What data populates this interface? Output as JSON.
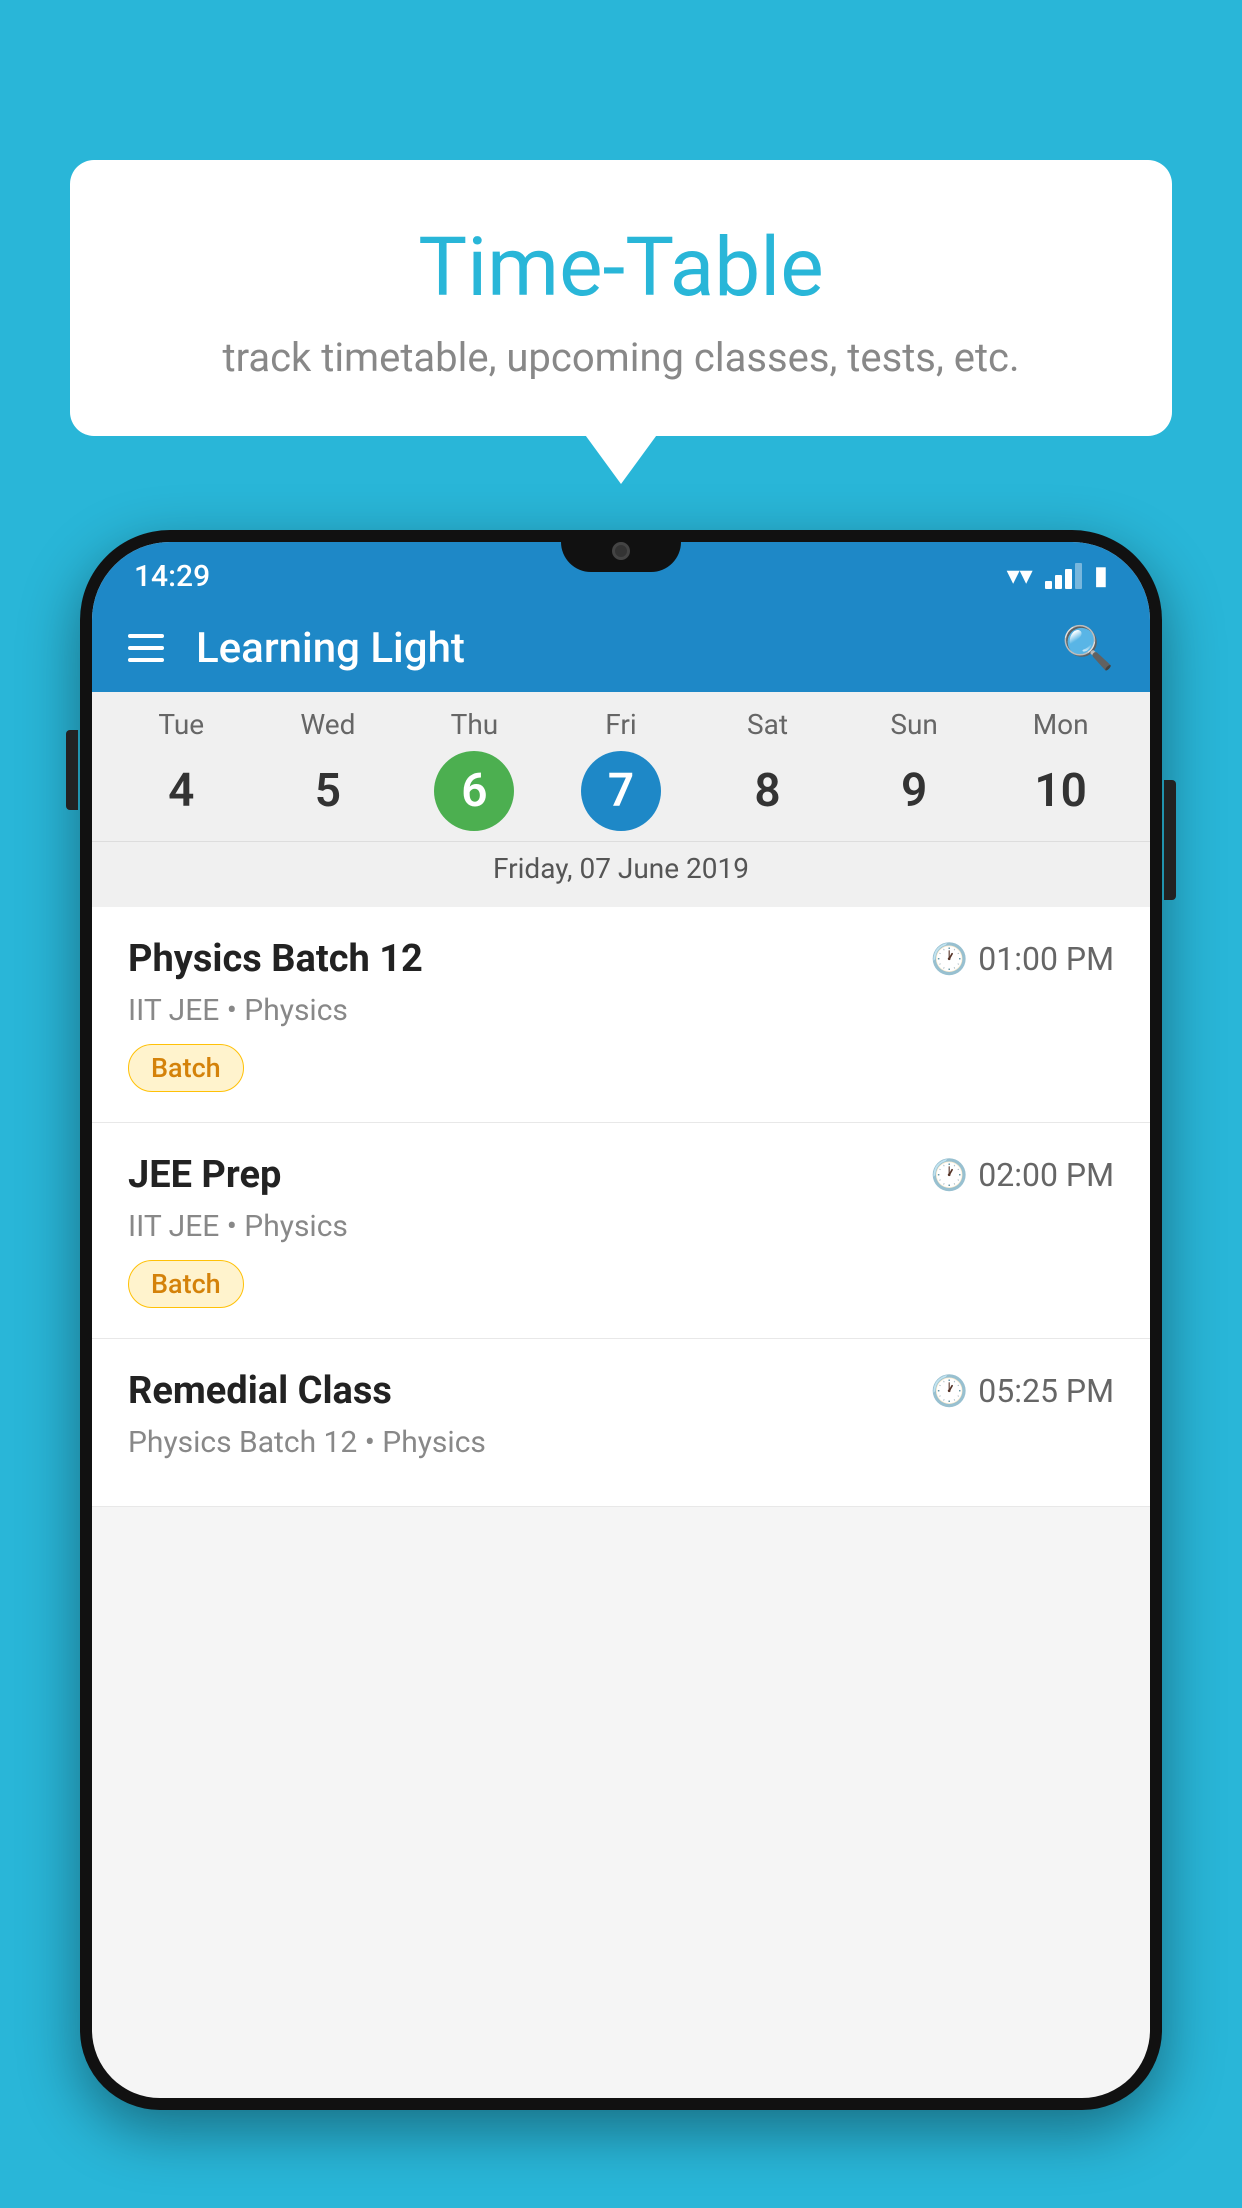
{
  "background_color": "#29b6d8",
  "speech_bubble": {
    "title": "Time-Table",
    "subtitle": "track timetable, upcoming classes, tests, etc."
  },
  "phone": {
    "status_bar": {
      "time": "14:29"
    },
    "toolbar": {
      "app_name": "Learning Light"
    },
    "calendar": {
      "days": [
        {
          "name": "Tue",
          "number": "4",
          "state": "normal"
        },
        {
          "name": "Wed",
          "number": "5",
          "state": "normal"
        },
        {
          "name": "Thu",
          "number": "6",
          "state": "today"
        },
        {
          "name": "Fri",
          "number": "7",
          "state": "selected"
        },
        {
          "name": "Sat",
          "number": "8",
          "state": "normal"
        },
        {
          "name": "Sun",
          "number": "9",
          "state": "normal"
        },
        {
          "name": "Mon",
          "number": "10",
          "state": "normal"
        }
      ],
      "selected_date_label": "Friday, 07 June 2019"
    },
    "schedule": [
      {
        "title": "Physics Batch 12",
        "time": "01:00 PM",
        "subtitle": "IIT JEE • Physics",
        "tag": "Batch"
      },
      {
        "title": "JEE Prep",
        "time": "02:00 PM",
        "subtitle": "IIT JEE • Physics",
        "tag": "Batch"
      },
      {
        "title": "Remedial Class",
        "time": "05:25 PM",
        "subtitle": "Physics Batch 12 • Physics",
        "tag": null
      }
    ]
  }
}
